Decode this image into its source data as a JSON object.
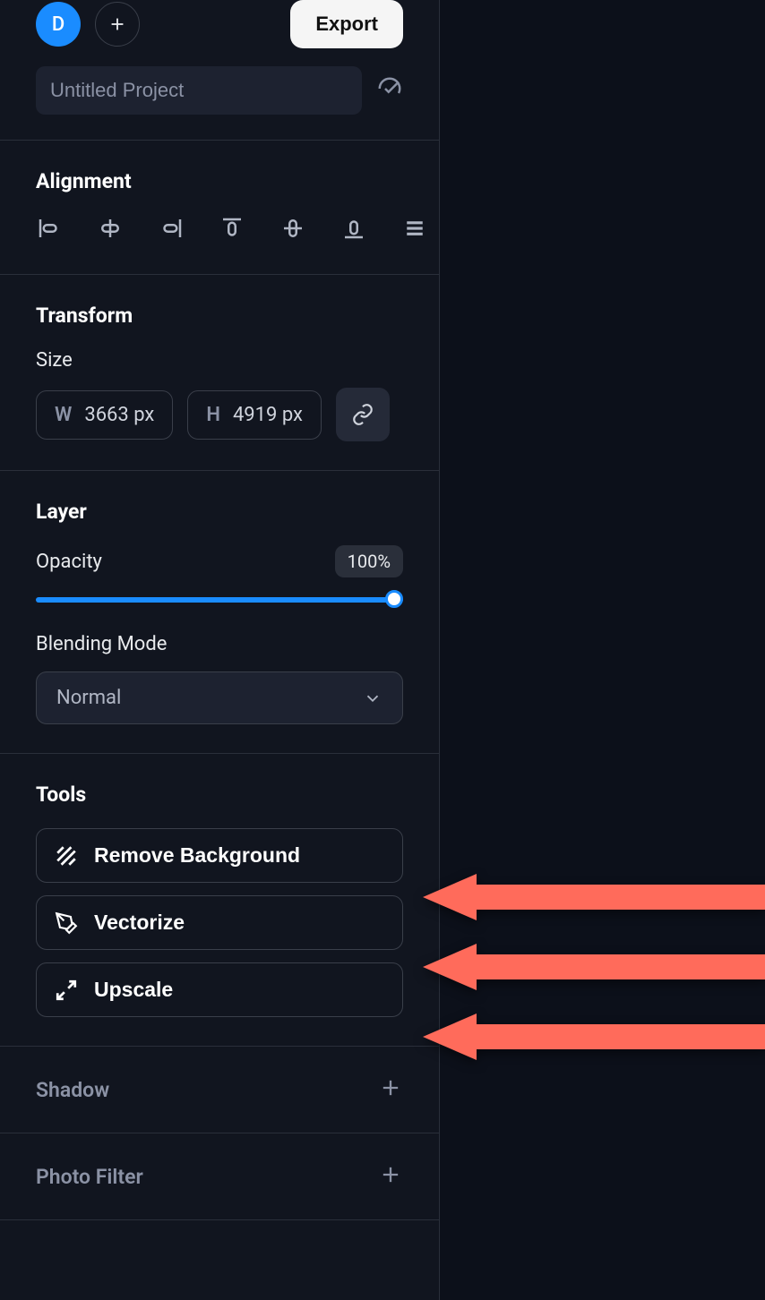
{
  "header": {
    "avatar_letter": "D",
    "export_label": "Export",
    "project_name": "Untitled Project"
  },
  "alignment": {
    "title": "Alignment"
  },
  "transform": {
    "title": "Transform",
    "size_label": "Size",
    "w_label": "W",
    "w_value": "3663 px",
    "h_label": "H",
    "h_value": "4919 px"
  },
  "layer": {
    "title": "Layer",
    "opacity_label": "Opacity",
    "opacity_value": "100%",
    "blend_label": "Blending Mode",
    "blend_value": "Normal"
  },
  "tools": {
    "title": "Tools",
    "remove_bg": "Remove Background",
    "vectorize": "Vectorize",
    "upscale": "Upscale"
  },
  "collapsed": {
    "shadow": "Shadow",
    "photo_filter": "Photo Filter"
  }
}
